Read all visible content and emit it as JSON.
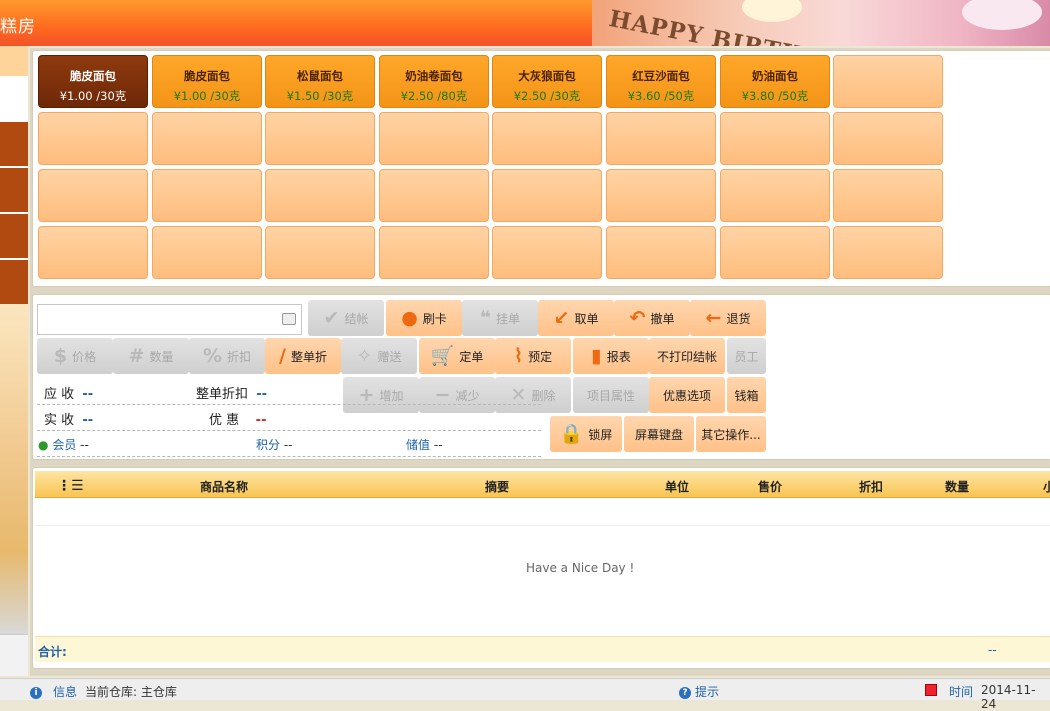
{
  "header": {
    "title": "糕房",
    "banner_text": "HAPPY BIRTHDAY"
  },
  "products": [
    {
      "name": "脆皮面包",
      "price": "¥1.00 /30克",
      "selected": true
    },
    {
      "name": "脆皮面包",
      "price": "¥1.00 /30克"
    },
    {
      "name": "松鼠面包",
      "price": "¥1.50 /30克"
    },
    {
      "name": "奶油卷面包",
      "price": "¥2.50 /80克"
    },
    {
      "name": "大灰狼面包",
      "price": "¥2.50 /30克"
    },
    {
      "name": "红豆沙面包",
      "price": "¥3.60 /50克"
    },
    {
      "name": "奶油面包",
      "price": "¥3.80 /50克"
    }
  ],
  "search": {
    "placeholder": ""
  },
  "buttons": {
    "checkout": "结帐",
    "swipe_card": "刷卡",
    "hang_order": "挂单",
    "take_order": "取单",
    "cancel_order": "撤单",
    "return_goods": "退货",
    "price": "价格",
    "quantity": "数量",
    "discount": "折扣",
    "whole_discount": "整单折",
    "gift": "赠送",
    "place_order": "定单",
    "reserve": "预定",
    "report": "报表",
    "no_print_checkout": "不打印结帐",
    "staff": "员工",
    "add": "增加",
    "reduce": "减少",
    "delete": "删除",
    "item_attributes": "项目属性",
    "promo_options": "优惠选项",
    "cash_drawer": "钱箱",
    "lock_screen": "锁屏",
    "screen_keyboard": "屏幕键盘",
    "other_ops": "其它操作..."
  },
  "summary": {
    "receivable_label": "应 收",
    "receivable_value": "--",
    "whole_discount_label": "整单折扣",
    "whole_discount_value": "--",
    "actual_label": "实 收",
    "actual_value": "--",
    "promo_label": "优 惠",
    "promo_value": "--"
  },
  "member": {
    "member_label": "会员",
    "member_value": "--",
    "points_label": "积分",
    "points_value": "--",
    "stored_label": "储值",
    "stored_value": "--"
  },
  "table": {
    "columns": [
      "商品名称",
      "摘要",
      "单位",
      "售价",
      "折扣",
      "数量",
      "小"
    ],
    "empty_message": "Have a Nice Day !",
    "total_label": "合计:",
    "total_value": "--"
  },
  "status": {
    "info_label": "信息",
    "warehouse": "当前仓库: 主仓库",
    "hint_label": "提示",
    "time_label": "时间",
    "time_value": "2014-11-24"
  }
}
